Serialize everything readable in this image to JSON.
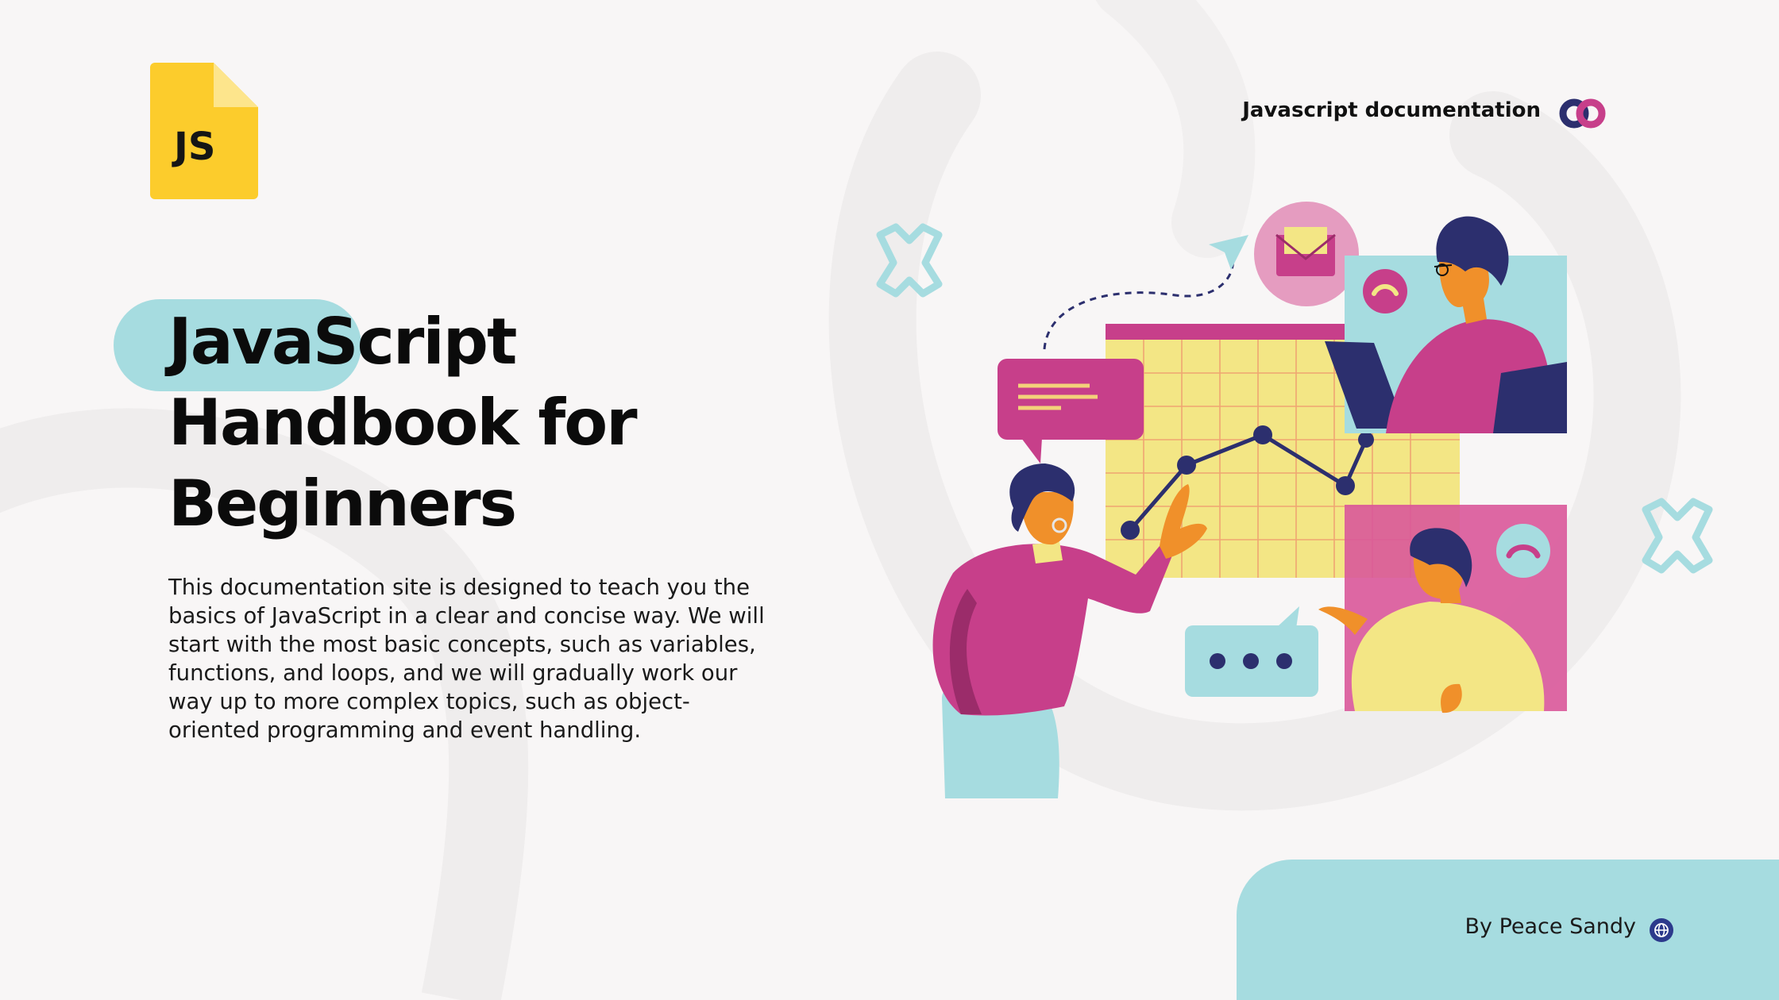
{
  "logo": {
    "text": "JS",
    "icon": "js-file-icon"
  },
  "header": {
    "title": "Javascript documentation",
    "brand_icon": "infinity-logo-icon"
  },
  "hero": {
    "title_lines": [
      "JavaScript",
      "Handbook for",
      "Beginners"
    ],
    "description": "This documentation site is designed to teach you the basics of JavaScript in a clear and concise way. We will start with the most basic concepts, such as variables, functions, and loops, and we will gradually work our way up to more complex topics, such as object-oriented programming and event handling."
  },
  "illustration": {
    "name": "team-analytics-illustration"
  },
  "footer": {
    "author": "By Peace Sandy",
    "icon": "globe-icon"
  },
  "colors": {
    "background": "#f8f6f6",
    "accent_teal": "#a6dce0",
    "accent_yellow": "#fccc2c",
    "magenta": "#c73f8a",
    "navy": "#2c2f6e",
    "chart_yellow": "#f3e685",
    "orange": "#f0902a"
  }
}
